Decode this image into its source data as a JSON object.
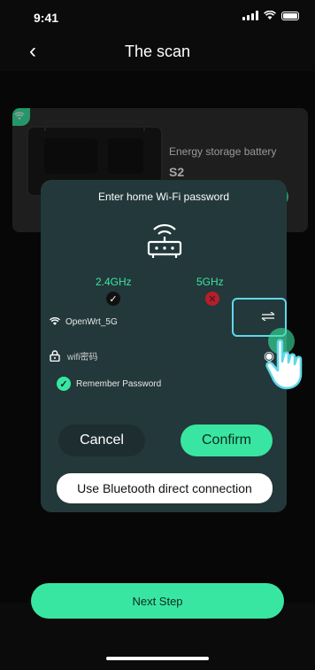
{
  "status_bar": {
    "time": "9:41"
  },
  "nav": {
    "title": "The scan",
    "back_icon": "chevron-left-icon"
  },
  "device_card": {
    "name": "Energy storage battery",
    "model": "S2"
  },
  "dialog": {
    "title": "Enter home Wi-Fi password",
    "band_24": {
      "label": "2.4GHz",
      "state": "supported"
    },
    "band_5": {
      "label": "5GHz",
      "state": "unsupported"
    },
    "ssid": "OpenWrt_5G",
    "password_placeholder": "wifi密码",
    "remember_label": "Remember Password",
    "remember_checked": true,
    "cancel_label": "Cancel",
    "confirm_label": "Confirm",
    "bluetooth_label": "Use Bluetooth direct connection"
  },
  "footer": {
    "next_label": "Next Step"
  },
  "colors": {
    "accent": "#39e6a1",
    "dialog_bg": "#23383b",
    "highlight": "#5fd8e8",
    "error": "#b81d2a"
  }
}
